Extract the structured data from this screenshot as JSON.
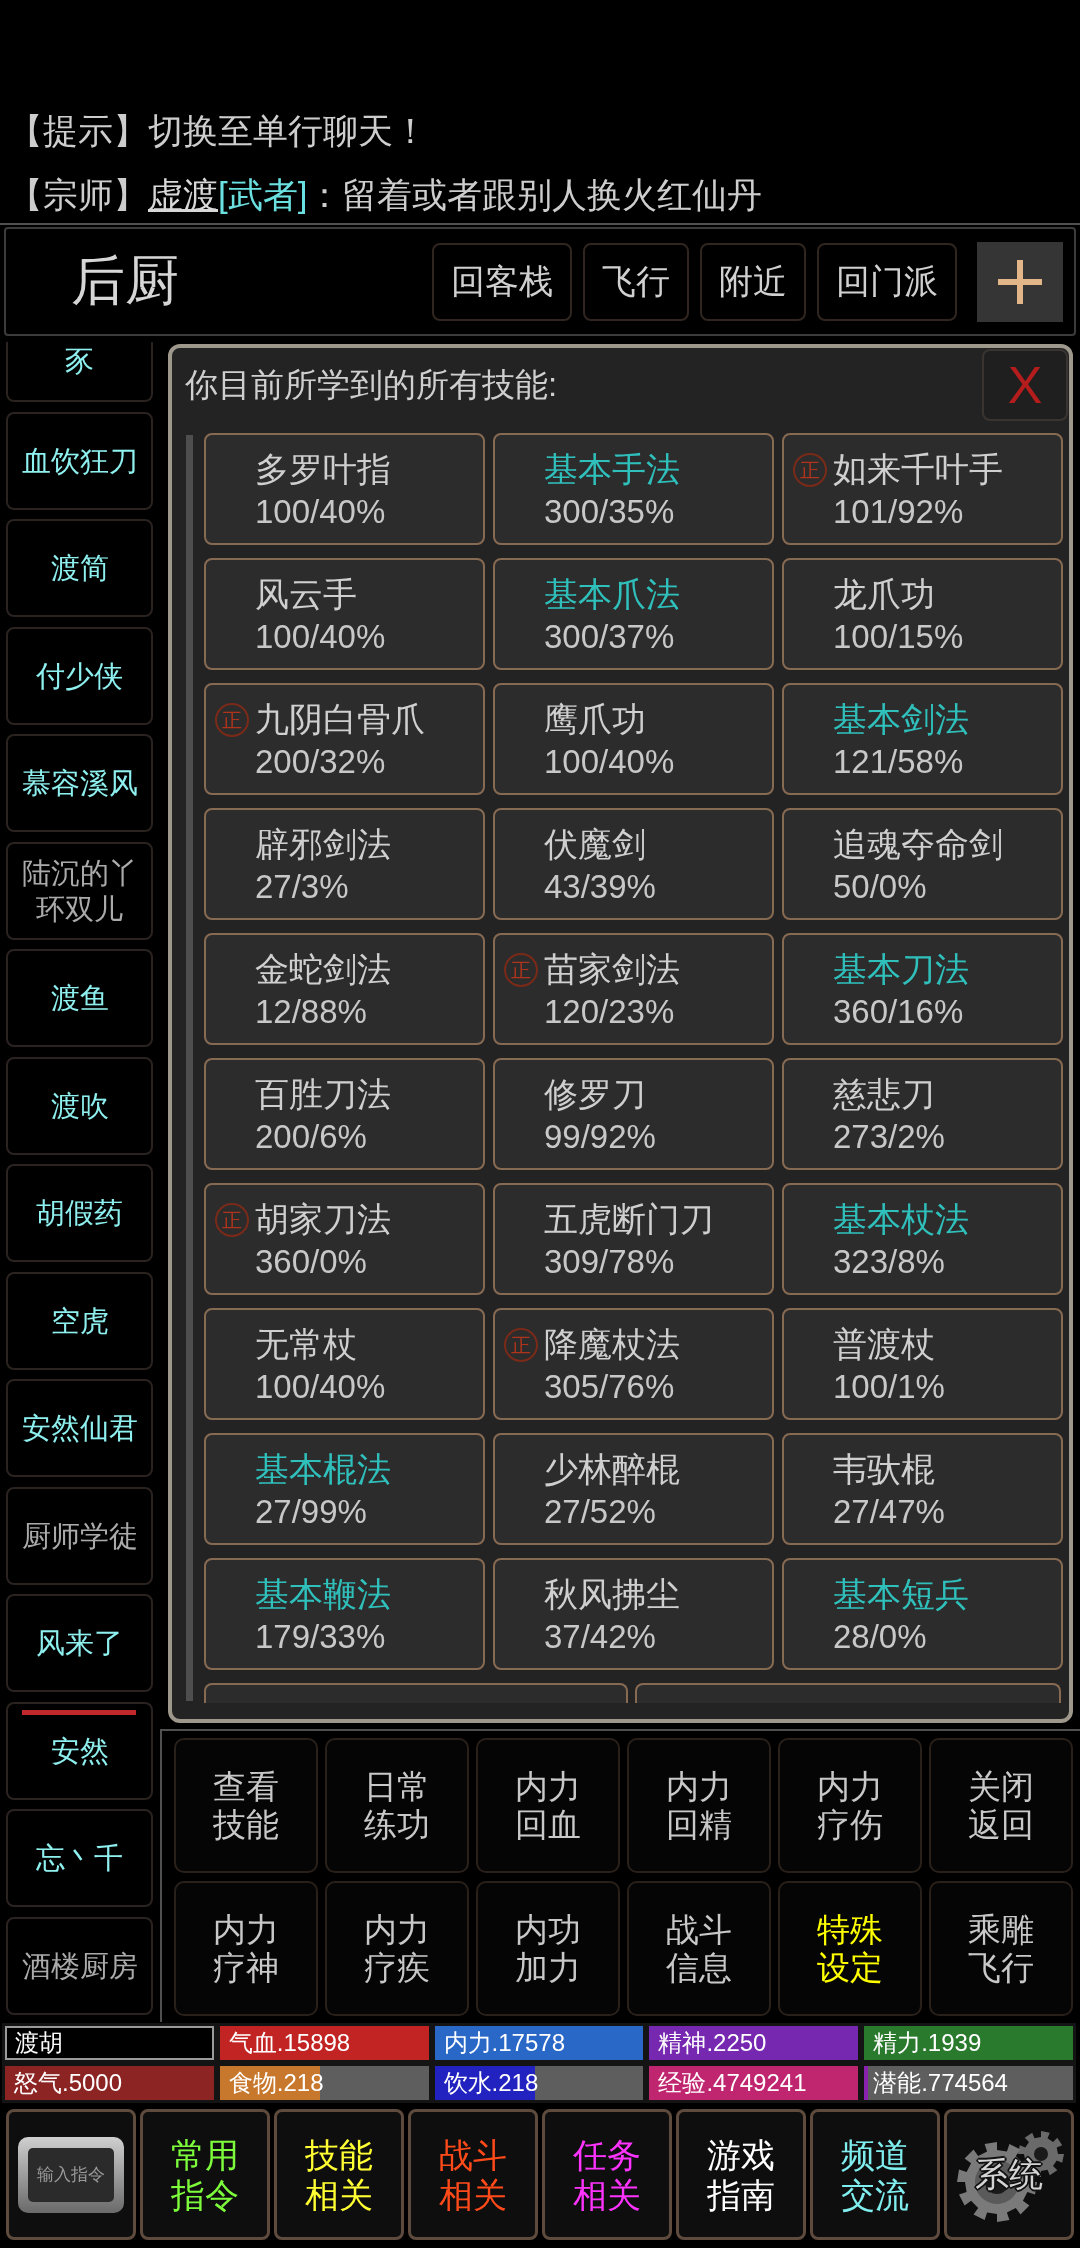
{
  "chat": [
    {
      "kind": "system",
      "text": "【提示】切换至单行聊天！"
    },
    {
      "kind": "player",
      "channel": "【宗师】",
      "name": "虚渡",
      "title": "[武者]",
      "message": "：留着或者跟别人换火红仙丹"
    }
  ],
  "location": {
    "title": "后厨",
    "buttons": [
      "回客栈",
      "飞行",
      "附近",
      "回门派"
    ]
  },
  "sidebar": {
    "clipped_item": {
      "label": "豕",
      "kind": "player"
    },
    "items": [
      {
        "label": "血饮狂刀",
        "kind": "player",
        "selected": false
      },
      {
        "label": "渡简",
        "kind": "player",
        "selected": false
      },
      {
        "label": "付少侠",
        "kind": "player",
        "selected": false
      },
      {
        "label": "慕容溪风",
        "kind": "player",
        "selected": false
      },
      {
        "label": "陆沉的丫环双儿",
        "kind": "npc",
        "selected": false
      },
      {
        "label": "渡鱼",
        "kind": "player",
        "selected": false
      },
      {
        "label": "渡吹",
        "kind": "player",
        "selected": false
      },
      {
        "label": "胡假药",
        "kind": "player",
        "selected": false
      },
      {
        "label": "空虎",
        "kind": "player",
        "selected": false
      },
      {
        "label": "安然仙君",
        "kind": "player",
        "selected": false
      },
      {
        "label": "厨师学徒",
        "kind": "npc",
        "selected": false
      },
      {
        "label": "风来了",
        "kind": "player",
        "selected": false
      },
      {
        "label": "安然",
        "kind": "player",
        "selected": true
      },
      {
        "label": "忘丶千",
        "kind": "player",
        "selected": false
      },
      {
        "label": "酒楼厨房",
        "kind": "npc",
        "selected": false
      }
    ]
  },
  "skills_panel": {
    "title": "你目前所学到的所有技能:",
    "close": "X",
    "skills": [
      {
        "name": "多罗叶指",
        "progress": "100/40%",
        "kind": "normal"
      },
      {
        "name": "基本手法",
        "progress": "300/35%",
        "kind": "basic"
      },
      {
        "name": "如来千叶手",
        "progress": "101/92%",
        "kind": "normal",
        "badge": "正"
      },
      {
        "name": "风云手",
        "progress": "100/40%",
        "kind": "normal"
      },
      {
        "name": "基本爪法",
        "progress": "300/37%",
        "kind": "basic"
      },
      {
        "name": "龙爪功",
        "progress": "100/15%",
        "kind": "normal"
      },
      {
        "name": "九阴白骨爪",
        "progress": "200/32%",
        "kind": "normal",
        "badge": "正"
      },
      {
        "name": "鹰爪功",
        "progress": "100/40%",
        "kind": "normal"
      },
      {
        "name": "基本剑法",
        "progress": "121/58%",
        "kind": "basic"
      },
      {
        "name": "辟邪剑法",
        "progress": "27/3%",
        "kind": "normal"
      },
      {
        "name": "伏魔剑",
        "progress": "43/39%",
        "kind": "normal"
      },
      {
        "name": "追魂夺命剑",
        "progress": "50/0%",
        "kind": "normal"
      },
      {
        "name": "金蛇剑法",
        "progress": "12/88%",
        "kind": "normal"
      },
      {
        "name": "苗家剑法",
        "progress": "120/23%",
        "kind": "normal",
        "badge": "正"
      },
      {
        "name": "基本刀法",
        "progress": "360/16%",
        "kind": "basic"
      },
      {
        "name": "百胜刀法",
        "progress": "200/6%",
        "kind": "normal"
      },
      {
        "name": "修罗刀",
        "progress": "99/92%",
        "kind": "normal"
      },
      {
        "name": "慈悲刀",
        "progress": "273/2%",
        "kind": "normal"
      },
      {
        "name": "胡家刀法",
        "progress": "360/0%",
        "kind": "normal",
        "badge": "正"
      },
      {
        "name": "五虎断门刀",
        "progress": "309/78%",
        "kind": "normal"
      },
      {
        "name": "基本杖法",
        "progress": "323/8%",
        "kind": "basic"
      },
      {
        "name": "无常杖",
        "progress": "100/40%",
        "kind": "normal"
      },
      {
        "name": "降魔杖法",
        "progress": "305/76%",
        "kind": "normal",
        "badge": "正"
      },
      {
        "name": "普渡杖",
        "progress": "100/1%",
        "kind": "normal"
      },
      {
        "name": "基本棍法",
        "progress": "27/99%",
        "kind": "basic"
      },
      {
        "name": "少林醉棍",
        "progress": "27/52%",
        "kind": "normal"
      },
      {
        "name": "韦驮棍",
        "progress": "27/47%",
        "kind": "normal"
      },
      {
        "name": "基本鞭法",
        "progress": "179/33%",
        "kind": "basic"
      },
      {
        "name": "秋风拂尘",
        "progress": "37/42%",
        "kind": "normal"
      },
      {
        "name": "基本短兵",
        "progress": "28/0%",
        "kind": "basic"
      }
    ]
  },
  "actions": [
    {
      "label": "查看技能",
      "color": "#c8c8c8"
    },
    {
      "label": "日常练功",
      "color": "#c8c8c8"
    },
    {
      "label": "内力回血",
      "color": "#c8c8c8"
    },
    {
      "label": "内力回精",
      "color": "#c8c8c8"
    },
    {
      "label": "内力疗伤",
      "color": "#c8c8c8"
    },
    {
      "label": "关闭返回",
      "color": "#c8c8c8"
    },
    {
      "label": "内力疗神",
      "color": "#c8c8c8"
    },
    {
      "label": "内力疗疾",
      "color": "#c8c8c8"
    },
    {
      "label": "内功加力",
      "color": "#c8c8c8"
    },
    {
      "label": "战斗信息",
      "color": "#c8c8c8"
    },
    {
      "label": "特殊设定",
      "color": "#ffff00"
    },
    {
      "label": "乘雕飞行",
      "color": "#c8c8c8"
    }
  ],
  "status": {
    "name": "渡胡",
    "bars": [
      {
        "label": "气血.15898",
        "color": "#c22424",
        "level": 1
      },
      {
        "label": "内力.17578",
        "color": "#2a68c8",
        "level": 1
      },
      {
        "label": "精神.2250",
        "color": "#7628b0",
        "level": 1
      },
      {
        "label": "精力.1939",
        "color": "#2a7a2e",
        "level": 1
      },
      {
        "label": "怒气.5000",
        "color": "#8c2424",
        "level": 1
      },
      {
        "label": "食物.218",
        "color": "#c8782c",
        "level": 0.48
      },
      {
        "label": "饮水.218",
        "color": "#2222c0",
        "level": 0.48
      },
      {
        "label": "经验.4749241",
        "color": "#c02670",
        "level": 1
      },
      {
        "label": "潜能.774564",
        "color": "#8a22b0",
        "level": 0.02
      }
    ]
  },
  "nav": [
    {
      "kind": "keycap",
      "label": "输入指令"
    },
    {
      "kind": "text",
      "label": "常用指令",
      "color": "#7dfc3c"
    },
    {
      "kind": "text",
      "label": "技能相关",
      "color": "#ffff33"
    },
    {
      "kind": "text",
      "label": "战斗相关",
      "color": "#ff4a1a"
    },
    {
      "kind": "text",
      "label": "任务相关",
      "color": "#ff33ff"
    },
    {
      "kind": "text",
      "label": "游戏指南",
      "color": "#ffffff"
    },
    {
      "kind": "text",
      "label": "频道交流",
      "color": "#80eeee"
    },
    {
      "kind": "gear",
      "label": "系统"
    }
  ]
}
